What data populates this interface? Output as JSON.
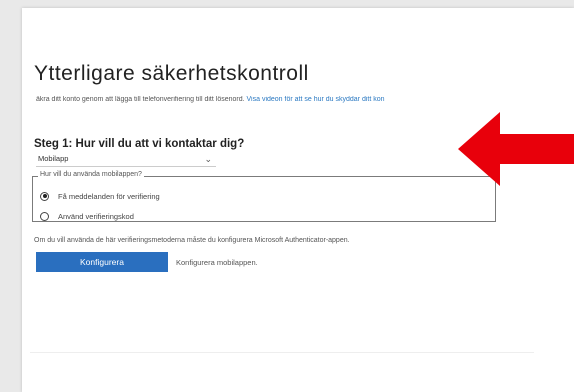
{
  "page": {
    "title": "Ytterligare säkerhetskontroll",
    "intro_text": "äkra ditt konto genom att lägga till telefonverifiering till ditt lösenord.",
    "intro_link": "Visa videon för att se hur du skyddar ditt kon"
  },
  "step1": {
    "heading": "Steg 1: Hur vill du att vi kontaktar dig?",
    "select_value": "Mobilapp"
  },
  "mobile_app": {
    "legend": "Hur vill du använda mobilappen?",
    "options": [
      {
        "label": "Få meddelanden för verifiering",
        "selected": true
      },
      {
        "label": "Använd verifieringskod",
        "selected": false
      }
    ]
  },
  "config": {
    "note": "Om du vill använda de här verifieringsmetoderna måste du konfigurera Microsoft Authenticator-appen.",
    "button_label": "Konfigurera",
    "button_description": "Konfigurera mobilappen."
  },
  "colors": {
    "button_bg": "#2a6fbf",
    "link": "#2b79c2",
    "arrow": "#e8000b"
  },
  "icons": {
    "dropdown": "chevron-down-icon",
    "annotation": "arrow-left-icon"
  }
}
